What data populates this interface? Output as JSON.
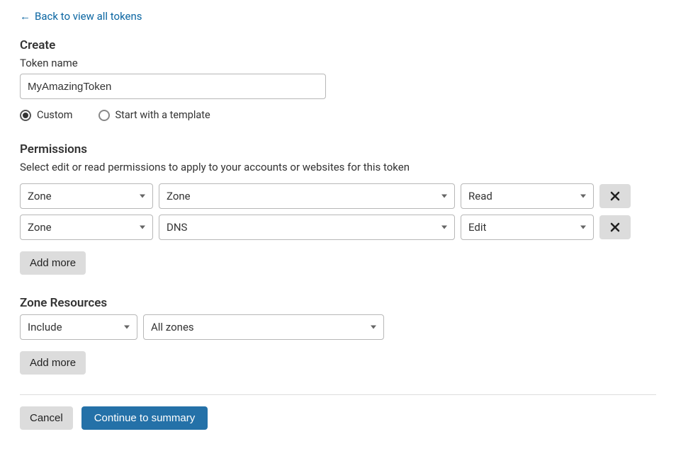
{
  "back_link": "Back to view all tokens",
  "create_heading": "Create",
  "token_name_label": "Token name",
  "token_name_value": "MyAmazingToken",
  "radios": {
    "custom": "Custom",
    "template": "Start with a template",
    "selected": "custom"
  },
  "permissions": {
    "title": "Permissions",
    "desc": "Select edit or read permissions to apply to your accounts or websites for this token",
    "rows": [
      {
        "scope": "Zone",
        "resource": "Zone",
        "access": "Read"
      },
      {
        "scope": "Zone",
        "resource": "DNS",
        "access": "Edit"
      }
    ],
    "add_more": "Add more"
  },
  "zone_resources": {
    "title": "Zone Resources",
    "rows": [
      {
        "mode": "Include",
        "target": "All zones"
      }
    ],
    "add_more": "Add more"
  },
  "footer": {
    "cancel": "Cancel",
    "continue": "Continue to summary"
  }
}
